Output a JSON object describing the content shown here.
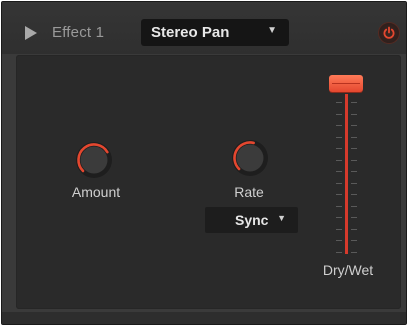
{
  "header": {
    "title": "Effect 1",
    "preset": "Stereo Pan",
    "preset_chevron": "▼",
    "power_icon": "power-icon",
    "play_icon": "play-icon"
  },
  "controls": {
    "amount": {
      "label": "Amount",
      "value": 0.72
    },
    "rate": {
      "label": "Rate",
      "value": 0.55
    },
    "sync": {
      "label": "Sync",
      "chevron": "▼"
    },
    "dry_wet": {
      "label": "Dry/Wet",
      "value": 1.0
    }
  },
  "colors": {
    "accent": "#e4472f",
    "background": "#2a2a2a",
    "header": "#333333"
  }
}
